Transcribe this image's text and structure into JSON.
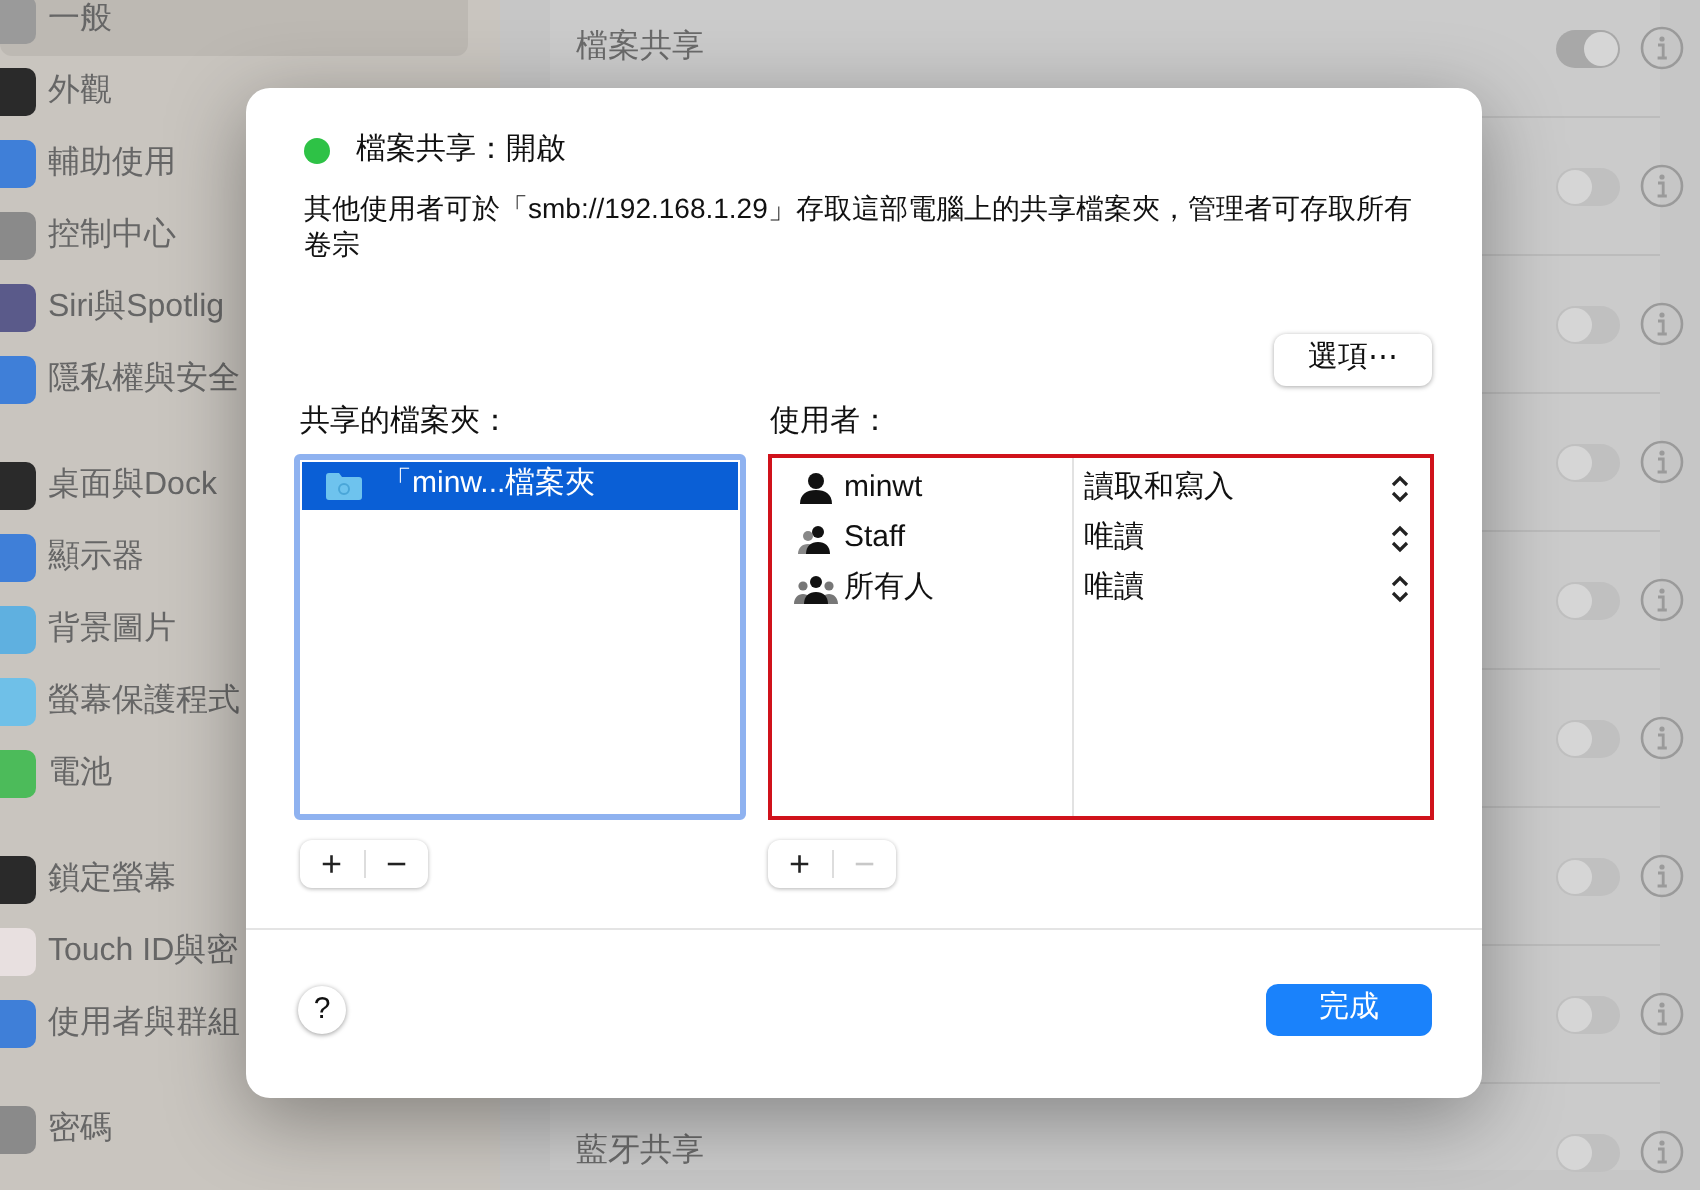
{
  "sidebar": {
    "groups": [
      [
        {
          "label": "一般",
          "color": "#9a9a9a",
          "selected": true
        },
        {
          "label": "外觀",
          "color": "#2a2a2a",
          "selected": false
        },
        {
          "label": "輔助使用",
          "color": "#3f7fd8",
          "selected": false
        },
        {
          "label": "控制中心",
          "color": "#8a8a8a",
          "selected": false
        },
        {
          "label": "Siri與Spotlig",
          "color": "#5a5a8a",
          "selected": false
        },
        {
          "label": "隱私權與安全",
          "color": "#3f7fd8",
          "selected": false
        }
      ],
      [
        {
          "label": "桌面與Dock",
          "color": "#2a2a2a",
          "selected": false
        },
        {
          "label": "顯示器",
          "color": "#3f7fd8",
          "selected": false
        },
        {
          "label": "背景圖片",
          "color": "#5fb0e0",
          "selected": false
        },
        {
          "label": "螢幕保護程式",
          "color": "#6fc0e8",
          "selected": false
        },
        {
          "label": "電池",
          "color": "#4cbb5a",
          "selected": false
        }
      ],
      [
        {
          "label": "鎖定螢幕",
          "color": "#2a2a2a",
          "selected": false
        },
        {
          "label": "Touch ID與密",
          "color": "#e8e0e0",
          "selected": false
        },
        {
          "label": "使用者與群組",
          "color": "#3f7fd8",
          "selected": false
        }
      ],
      [
        {
          "label": "密碼",
          "color": "#8a8a8a",
          "selected": false
        }
      ]
    ]
  },
  "content": {
    "rows": [
      {
        "title": "檔案共享",
        "on": true
      },
      {
        "on": false
      },
      {
        "on": false
      },
      {
        "on": false
      },
      {
        "on": false
      },
      {
        "on": false
      },
      {
        "on": false
      },
      {
        "on": false
      },
      {
        "title": "藍牙共享",
        "on": false
      }
    ]
  },
  "dialog": {
    "status": {
      "on": true,
      "title": "檔案共享：開啟"
    },
    "description": "其他使用者可於「smb://192.168.1.29」存取這部電腦上的共享檔案夾，管理者可存取所有卷宗",
    "options_button": "選項⋯",
    "folders": {
      "label": "共享的檔案夾：",
      "items": [
        {
          "name": "「minw...檔案夾",
          "selected": true
        }
      ],
      "add": "+",
      "remove": "−",
      "remove_disabled": false
    },
    "users": {
      "label": "使用者：",
      "highlighted": true,
      "items": [
        {
          "kind": "user",
          "name": "minwt",
          "permission": "讀取和寫入"
        },
        {
          "kind": "group",
          "name": "Staff",
          "permission": "唯讀"
        },
        {
          "kind": "everyone",
          "name": "所有人",
          "permission": "唯讀"
        }
      ],
      "add": "+",
      "remove": "−",
      "remove_disabled": true
    },
    "help": "?",
    "done": "完成"
  }
}
